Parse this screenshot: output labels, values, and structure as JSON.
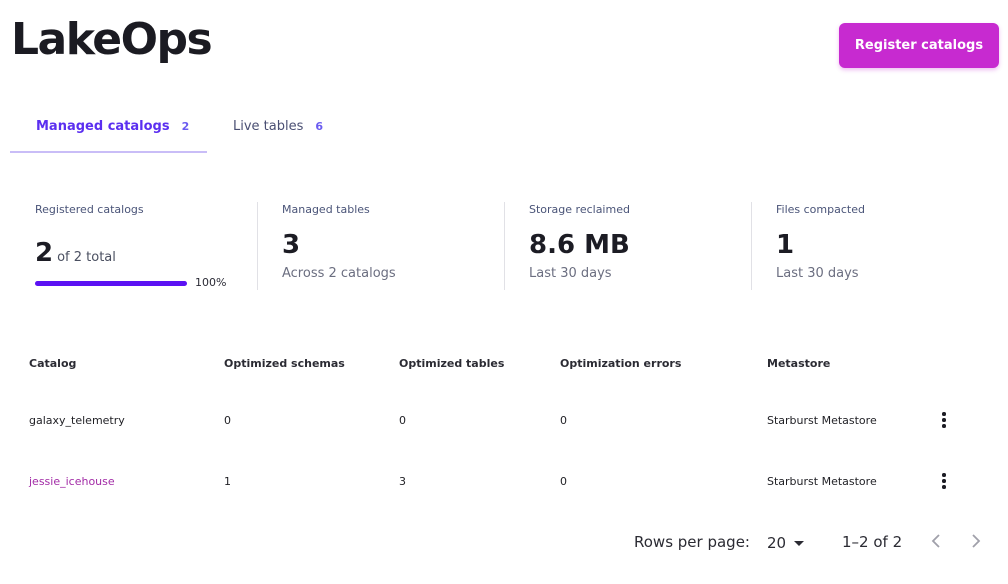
{
  "header": {
    "title": "LakeOps",
    "register_label": "Register catalogs"
  },
  "tabs": [
    {
      "label": "Managed catalogs",
      "count": "2",
      "active": true
    },
    {
      "label": "Live tables",
      "count": "6",
      "active": false
    }
  ],
  "stats": {
    "registered": {
      "label": "Registered catalogs",
      "value": "2",
      "of_total": "of 2 total",
      "progress_fraction": 1.0,
      "progress_pct": "100%"
    },
    "managed_tables": {
      "label": "Managed tables",
      "value": "3",
      "sub": "Across 2 catalogs"
    },
    "storage": {
      "label": "Storage reclaimed",
      "value": "8.6 MB",
      "sub": "Last 30 days"
    },
    "files": {
      "label": "Files compacted",
      "value": "1",
      "sub": "Last 30 days"
    }
  },
  "table": {
    "headers": {
      "catalog": "Catalog",
      "schemas": "Optimized schemas",
      "tables": "Optimized tables",
      "errors": "Optimization errors",
      "metastore": "Metastore"
    },
    "rows": [
      {
        "catalog": "galaxy_telemetry",
        "schemas": "0",
        "tables": "0",
        "errors": "0",
        "metastore": "Starburst Metastore"
      },
      {
        "catalog": "jessie_icehouse",
        "schemas": "1",
        "tables": "3",
        "errors": "0",
        "metastore": "Starburst Metastore"
      }
    ]
  },
  "pagination": {
    "rows_per_page_label": "Rows per page:",
    "rows_per_page": "20",
    "range": "1–2 of 2"
  },
  "icons": {
    "row_menu": "more-vertical-icon",
    "prev": "chevron-left-icon",
    "next": "chevron-right-icon",
    "dropdown": "caret-down-icon"
  },
  "colors": {
    "brand_button": "#c72ad0",
    "active_tab": "#5b2ff0",
    "progress": "#5b11f3",
    "link": "#a22ba6"
  }
}
